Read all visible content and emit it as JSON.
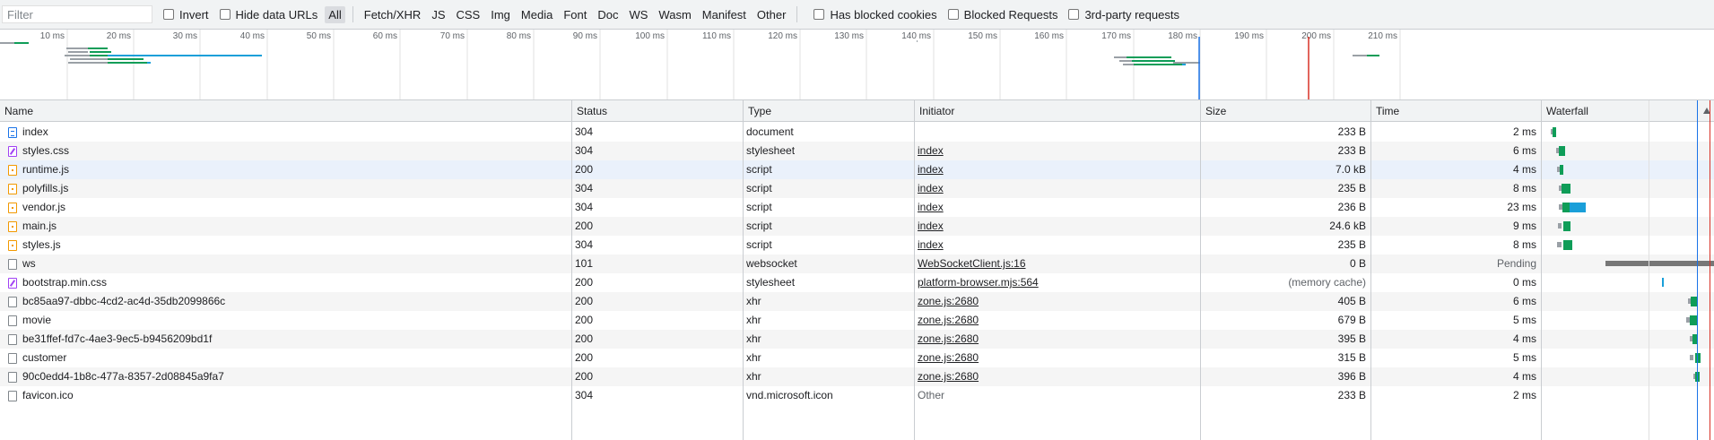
{
  "filterbar": {
    "placeholder": "Filter",
    "invert": "Invert",
    "hide_data_urls": "Hide data URLs",
    "types": [
      "All",
      "Fetch/XHR",
      "JS",
      "CSS",
      "Img",
      "Media",
      "Font",
      "Doc",
      "WS",
      "Wasm",
      "Manifest",
      "Other"
    ],
    "active_type": "All",
    "has_blocked_cookies": "Has blocked cookies",
    "blocked_requests": "Blocked Requests",
    "third_party": "3rd-party requests"
  },
  "overview": {
    "ticks": [
      "10 ms",
      "20 ms",
      "30 ms",
      "40 ms",
      "50 ms",
      "60 ms",
      "70 ms",
      "80 ms",
      "90 ms",
      "100 ms",
      "110 ms",
      "120 ms",
      "130 ms",
      "140 ms",
      "150 ms",
      "160 ms",
      "170 ms",
      "180 ms",
      "190 ms",
      "200 ms",
      "210 ms"
    ]
  },
  "columns": {
    "name": "Name",
    "status": "Status",
    "type": "Type",
    "initiator": "Initiator",
    "size": "Size",
    "time": "Time",
    "waterfall": "Waterfall"
  },
  "rows": [
    {
      "name": "index",
      "icon": "document-icon",
      "status": "304",
      "type": "document",
      "initiator": "",
      "initiator_link": false,
      "size": "233 B",
      "time": "2 ms"
    },
    {
      "name": "styles.css",
      "icon": "stylesheet-icon",
      "status": "304",
      "type": "stylesheet",
      "initiator": "index",
      "initiator_link": true,
      "size": "233 B",
      "time": "6 ms"
    },
    {
      "name": "runtime.js",
      "icon": "script-icon",
      "status": "200",
      "type": "script",
      "initiator": "index",
      "initiator_link": true,
      "size": "7.0 kB",
      "time": "4 ms"
    },
    {
      "name": "polyfills.js",
      "icon": "script-icon",
      "status": "304",
      "type": "script",
      "initiator": "index",
      "initiator_link": true,
      "size": "235 B",
      "time": "8 ms"
    },
    {
      "name": "vendor.js",
      "icon": "script-icon",
      "status": "304",
      "type": "script",
      "initiator": "index",
      "initiator_link": true,
      "size": "236 B",
      "time": "23 ms"
    },
    {
      "name": "main.js",
      "icon": "script-icon",
      "status": "200",
      "type": "script",
      "initiator": "index",
      "initiator_link": true,
      "size": "24.6 kB",
      "time": "9 ms"
    },
    {
      "name": "styles.js",
      "icon": "script-icon",
      "status": "304",
      "type": "script",
      "initiator": "index",
      "initiator_link": true,
      "size": "235 B",
      "time": "8 ms"
    },
    {
      "name": "ws",
      "icon": "file-icon",
      "status": "101",
      "type": "websocket",
      "initiator": "WebSocketClient.js:16",
      "initiator_link": true,
      "size": "0 B",
      "time": "Pending"
    },
    {
      "name": "bootstrap.min.css",
      "icon": "stylesheet-icon",
      "status": "200",
      "type": "stylesheet",
      "initiator": "platform-browser.mjs:564",
      "initiator_link": true,
      "size": "(memory cache)",
      "time": "0 ms"
    },
    {
      "name": "bc85aa97-dbbc-4cd2-ac4d-35db2099866c",
      "icon": "file-icon",
      "status": "200",
      "type": "xhr",
      "initiator": "zone.js:2680",
      "initiator_link": true,
      "size": "405 B",
      "time": "6 ms"
    },
    {
      "name": "movie",
      "icon": "file-icon",
      "status": "200",
      "type": "xhr",
      "initiator": "zone.js:2680",
      "initiator_link": true,
      "size": "679 B",
      "time": "5 ms"
    },
    {
      "name": "be31ffef-fd7c-4ae3-9ec5-b9456209bd1f",
      "icon": "file-icon",
      "status": "200",
      "type": "xhr",
      "initiator": "zone.js:2680",
      "initiator_link": true,
      "size": "395 B",
      "time": "4 ms"
    },
    {
      "name": "customer",
      "icon": "file-icon",
      "status": "200",
      "type": "xhr",
      "initiator": "zone.js:2680",
      "initiator_link": true,
      "size": "315 B",
      "time": "5 ms"
    },
    {
      "name": "90c0edd4-1b8c-477a-8357-2d08845a9fa7",
      "icon": "file-icon",
      "status": "200",
      "type": "xhr",
      "initiator": "zone.js:2680",
      "initiator_link": true,
      "size": "396 B",
      "time": "4 ms"
    },
    {
      "name": "favicon.ico",
      "icon": "file-icon",
      "status": "304",
      "type": "vnd.microsoft.icon",
      "initiator": "Other",
      "initiator_link": false,
      "size": "233 B",
      "time": "2 ms"
    }
  ],
  "colors": {
    "waiting": "#9aa0a6",
    "download": "#1a9fd9",
    "ttfb": "#0f9d58",
    "dom_line": "#1a73e8",
    "load_line": "#d93025"
  }
}
